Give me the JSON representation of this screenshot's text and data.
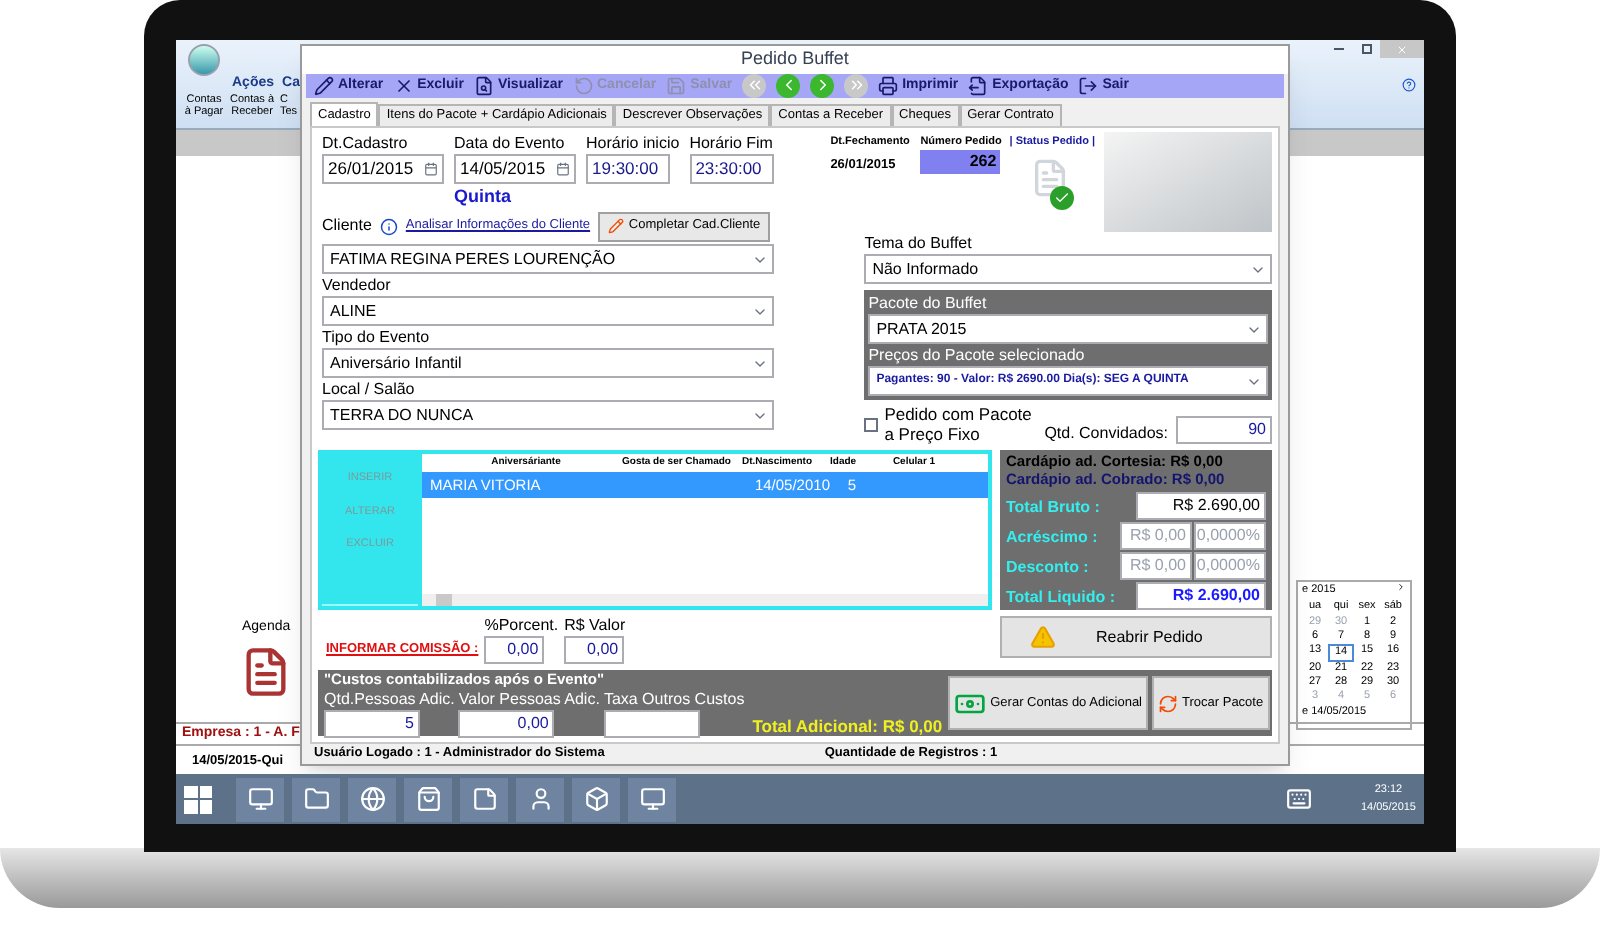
{
  "background_app": {
    "ribbon_tabs": [
      {
        "label": "Ações"
      },
      {
        "label": "Ca"
      }
    ],
    "ribbon_buttons": [
      {
        "lines": [
          "Contas",
          "à Pagar"
        ]
      },
      {
        "lines": [
          "Contas à",
          "Receber"
        ]
      },
      {
        "lines": [
          "C",
          "Tes"
        ]
      }
    ],
    "agenda_label": "Agenda",
    "calendar": {
      "title": "e 2015",
      "weekdays": [
        "ua",
        "qui",
        "sex",
        "sáb"
      ],
      "weeks": [
        [
          {
            "label": "29",
            "muted": true,
            "selected": false
          },
          {
            "label": "30",
            "muted": true,
            "selected": false
          },
          {
            "label": "1",
            "muted": false,
            "selected": false
          },
          {
            "label": "2",
            "muted": false,
            "selected": false
          }
        ],
        [
          {
            "label": "6",
            "muted": false,
            "selected": false
          },
          {
            "label": "7",
            "muted": false,
            "selected": false
          },
          {
            "label": "8",
            "muted": false,
            "selected": false
          },
          {
            "label": "9",
            "muted": false,
            "selected": false
          }
        ],
        [
          {
            "label": "13",
            "muted": false,
            "selected": false
          },
          {
            "label": "14",
            "muted": false,
            "selected": true
          },
          {
            "label": "15",
            "muted": false,
            "selected": false
          },
          {
            "label": "16",
            "muted": false,
            "selected": false
          }
        ],
        [
          {
            "label": "20",
            "muted": false,
            "selected": false
          },
          {
            "label": "21",
            "muted": false,
            "selected": false
          },
          {
            "label": "22",
            "muted": false,
            "selected": false
          },
          {
            "label": "23",
            "muted": false,
            "selected": false
          }
        ],
        [
          {
            "label": "27",
            "muted": false,
            "selected": false
          },
          {
            "label": "28",
            "muted": false,
            "selected": false
          },
          {
            "label": "29",
            "muted": false,
            "selected": false
          },
          {
            "label": "30",
            "muted": false,
            "selected": false
          }
        ],
        [
          {
            "label": "3",
            "muted": true,
            "selected": false
          },
          {
            "label": "4",
            "muted": true,
            "selected": false
          },
          {
            "label": "5",
            "muted": true,
            "selected": false
          },
          {
            "label": "6",
            "muted": true,
            "selected": false
          }
        ]
      ],
      "today": "e 14/05/2015"
    },
    "company_status": "Empresa : 1 - A. F",
    "date_status": "14/05/2015-Qui"
  },
  "dialog": {
    "title": "Pedido Buffet",
    "toolbar": [
      {
        "kind": "button",
        "label": "Alterar",
        "disabled": false
      },
      {
        "kind": "button",
        "label": "Excluir",
        "disabled": false
      },
      {
        "kind": "button",
        "label": "Visualizar",
        "disabled": false
      },
      {
        "kind": "button",
        "label": "Cancelar",
        "disabled": true
      },
      {
        "kind": "button",
        "label": "Salvar",
        "disabled": true
      },
      {
        "kind": "nav",
        "disabled": true
      },
      {
        "kind": "nav",
        "disabled": false
      },
      {
        "kind": "nav",
        "disabled": false
      },
      {
        "kind": "nav",
        "disabled": true
      },
      {
        "kind": "button",
        "label": "Imprimir",
        "disabled": false
      },
      {
        "kind": "button",
        "label": "Exportação",
        "disabled": false
      },
      {
        "kind": "button",
        "label": "Sair",
        "disabled": false
      }
    ],
    "tabs": [
      {
        "label": "Cadastro",
        "selected": true
      },
      {
        "label": "Itens do Pacote + Cardápio Adicionais",
        "selected": false
      },
      {
        "label": "Descrever Observações",
        "selected": false
      },
      {
        "label": "Contas a Receber",
        "selected": false
      },
      {
        "label": "Cheques",
        "selected": false
      },
      {
        "label": "Gerar Contrato",
        "selected": false
      }
    ],
    "dates": [
      {
        "kind": "date",
        "label": "Dt.Cadastro",
        "value": "26/01/2015"
      },
      {
        "kind": "date",
        "label": "Data do Evento",
        "value": "14/05/2015"
      },
      {
        "kind": "time",
        "label": "Horário inicio",
        "value": "19:30:00"
      },
      {
        "kind": "time",
        "label": "Horário Fim",
        "value": "23:30:00"
      }
    ],
    "weekday": "Quinta",
    "closing": {
      "label": "Dt.Fechamento",
      "value": "26/01/2015"
    },
    "order_number": {
      "label": "Número Pedido",
      "value": "262"
    },
    "status_label": "| Status Pedido |",
    "client_link": "Analisar Informações do Cliente",
    "complete_button": "Completar Cad.Cliente",
    "left_combos": [
      {
        "label": "Cliente",
        "value": "FATIMA REGINA PERES LOURENÇÃO"
      },
      {
        "label": "Vendedor",
        "value": "ALINE"
      },
      {
        "label": "Tipo do Evento",
        "value": "Aniversário Infantil"
      },
      {
        "label": "Local / Salão",
        "value": "TERRA DO NUNCA"
      }
    ],
    "theme": {
      "label": "Tema do Buffet",
      "value": "Não Informado"
    },
    "package": {
      "label": "Pacote do Buffet",
      "value": "PRATA 2015",
      "prices_label": "Preços do Pacote selecionado",
      "prices_value": "Pagantes: 90 - Valor: R$ 2690.00 Dia(s): SEG A QUINTA"
    },
    "fixed_price": {
      "label": "Pedido com Pacote a Preço Fixo",
      "checked": false
    },
    "guests": {
      "label": "Qtd. Convidados:",
      "value": "90"
    },
    "grid_buttons": [
      {
        "label": "INSERIR",
        "disabled": true
      },
      {
        "label": "ALTERAR",
        "disabled": true
      },
      {
        "label": "EXCLUIR",
        "disabled": true
      }
    ],
    "grid": {
      "columns": [
        "Aniversáriante",
        "Gosta de ser Chamado",
        "Dt.Nascimento",
        "Idade",
        "Celular 1"
      ],
      "rows": [
        {
          "selected": true,
          "cells": [
            "MARIA VITORIA",
            "",
            "14/05/2010",
            "5",
            ""
          ]
        }
      ]
    },
    "extras": {
      "courtesy": "Cardápio ad. Cortesia: R$ 0,00",
      "charged": "Cardápio ad. Cobrado: R$ 0,00"
    },
    "totals": [
      {
        "label": "Total Bruto :",
        "values": [
          "R$ 2.690,00"
        ]
      },
      {
        "label": "Acréscimo :",
        "values": [
          "R$ 0,00",
          "0,0000%"
        ]
      },
      {
        "label": "Desconto :",
        "values": [
          "R$ 0,00",
          "0,0000%"
        ]
      },
      {
        "label": "Total Liquido :",
        "values": [
          "R$ 2.690,00"
        ]
      }
    ],
    "commission": {
      "label": "INFORMAR COMISSÃO :",
      "fields": [
        {
          "label": "%Porcent.",
          "value": "0,00"
        },
        {
          "label": "R$ Valor",
          "value": "0,00"
        }
      ]
    },
    "reopen_button": "Reabrir Pedido",
    "post_event": {
      "title": "\"Custos contabilizados após o Evento\"",
      "fields": [
        {
          "label": "Qtd.Pessoas Adic.",
          "value": "5"
        },
        {
          "label": "Valor Pessoas Adic.",
          "value": "0,00"
        },
        {
          "label": "Taxa Outros Custos"
        }
      ],
      "total": "Total Adicional: R$  0,00",
      "buttons": [
        "Gerar Contas do Adicional",
        "Trocar Pacote"
      ]
    },
    "status_bar": [
      "Usuário Logado : 1 - Administrador do Sistema",
      "Quantidade de Registros : 1"
    ]
  },
  "taskbar": {
    "time": "23:12",
    "date": "14/05/2015"
  }
}
